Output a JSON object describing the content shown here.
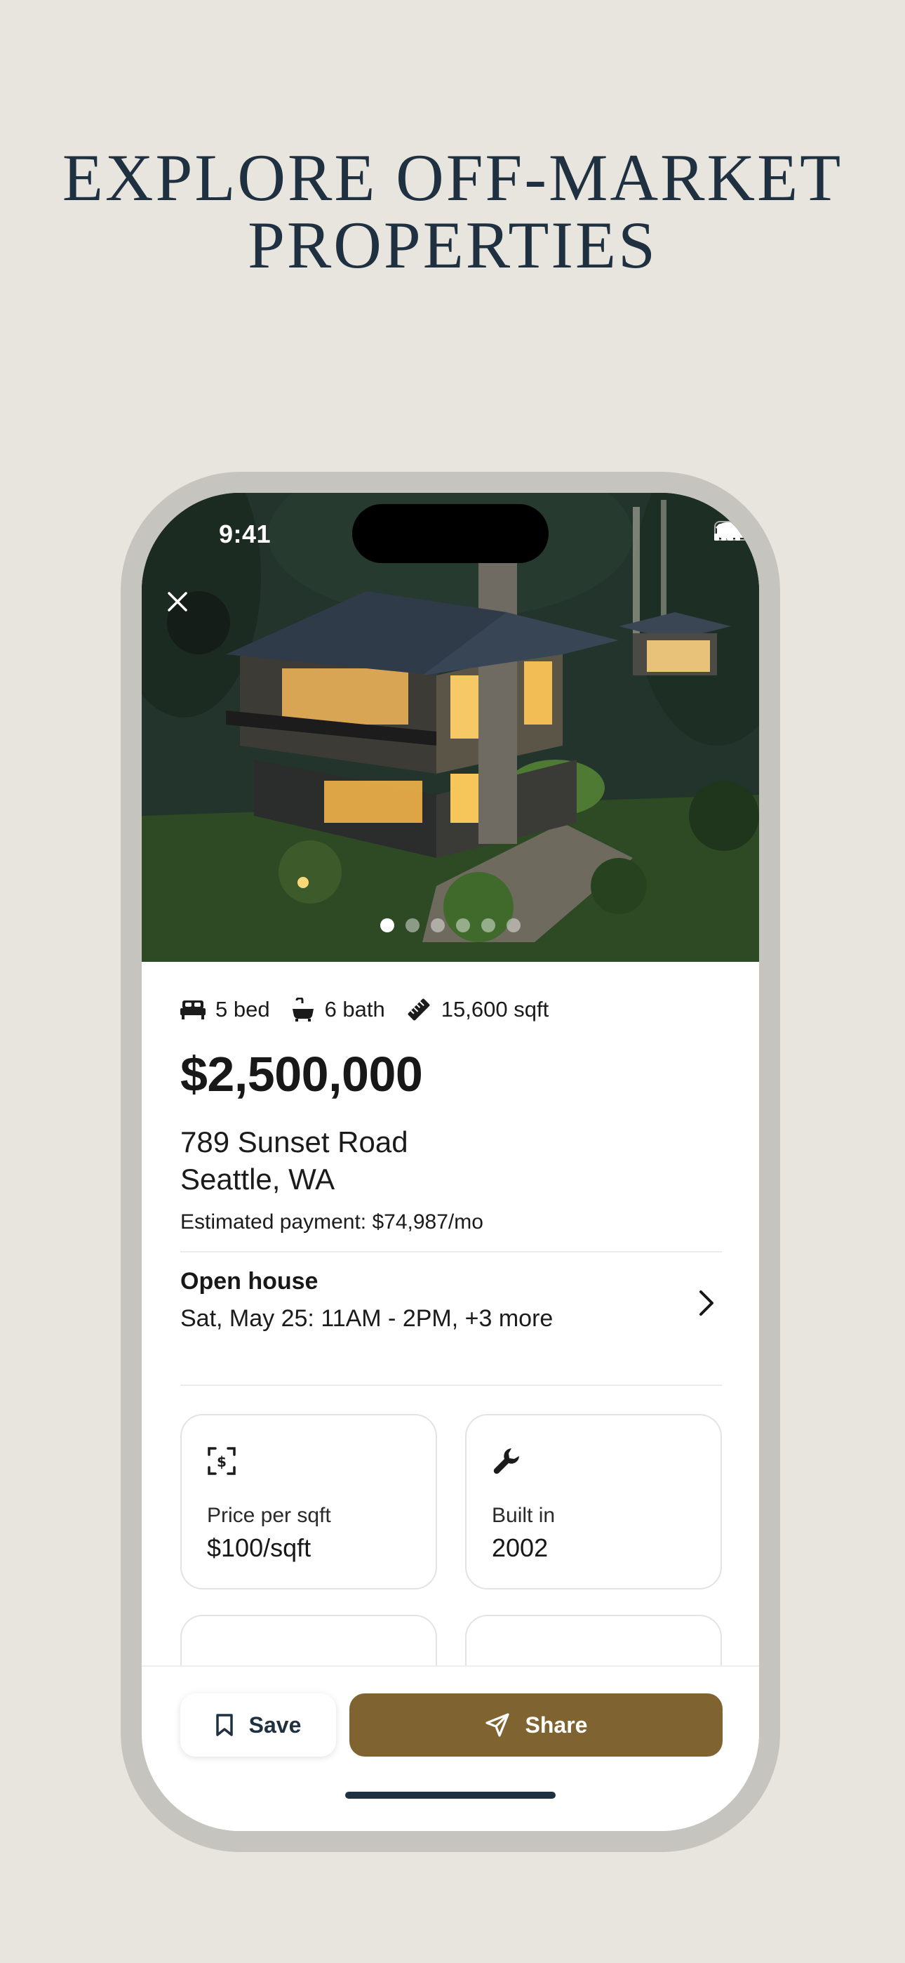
{
  "headline": {
    "line1": "EXPLORE OFF-MARKET",
    "line2": "PROPERTIES"
  },
  "status_bar": {
    "time": "9:41",
    "icons": [
      "signal-icon",
      "wifi-icon",
      "battery-icon"
    ]
  },
  "gallery": {
    "photo_count": 6,
    "current_index": 1
  },
  "listing": {
    "facts": [
      {
        "icon": "bed-icon",
        "label": "5 bed"
      },
      {
        "icon": "bathtub-icon",
        "label": "6 bath"
      },
      {
        "icon": "ruler-icon",
        "label": "15,600 sqft"
      }
    ],
    "price": "$2,500,000",
    "address_line1": "789 Sunset Road",
    "address_line2": "Seattle, WA",
    "estimated_payment": "Estimated payment: $74,987/mo"
  },
  "open_house": {
    "title": "Open house",
    "schedule": "Sat, May 25: 11AM - 2PM, +3 more"
  },
  "cards": [
    {
      "icon": "price-tag-icon",
      "label": "Price per sqft",
      "value": "$100/sqft"
    },
    {
      "icon": "wrench-icon",
      "label": "Built in",
      "value": "2002"
    }
  ],
  "actions": {
    "save_label": "Save",
    "share_label": "Share"
  },
  "colors": {
    "accent": "#7f6330",
    "navy": "#1f3140",
    "background": "#e8e5df"
  }
}
